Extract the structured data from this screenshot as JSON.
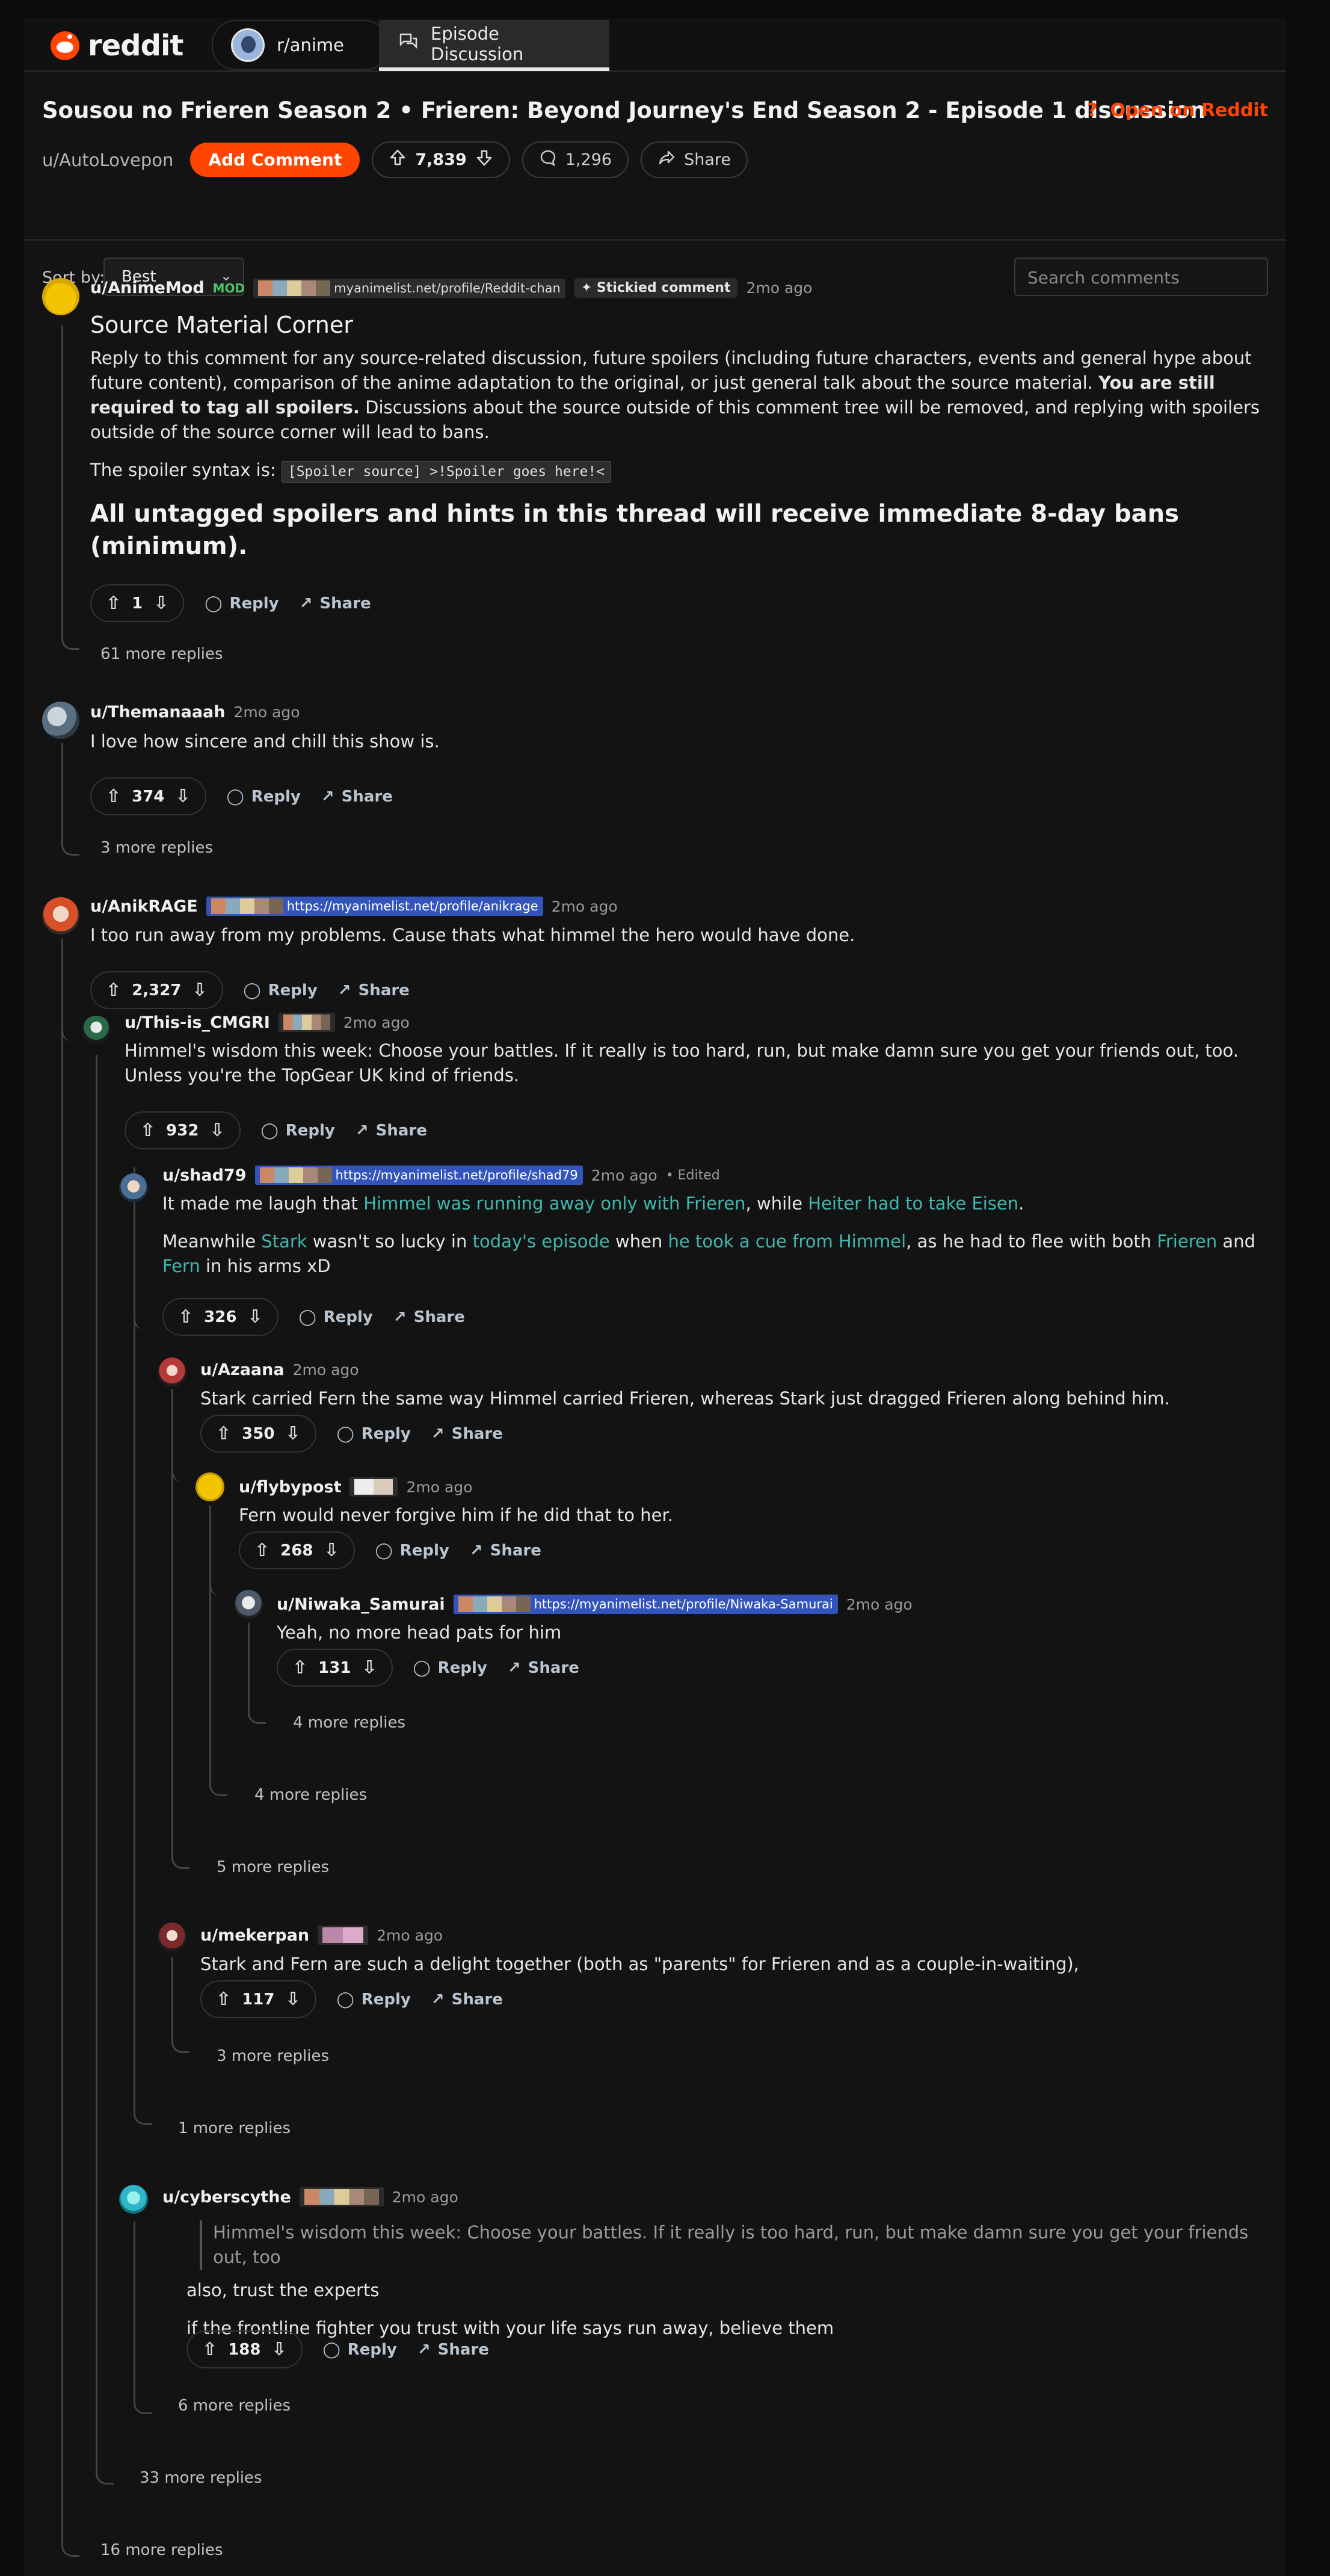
{
  "topbar": {
    "logo_text": "reddit",
    "subreddit_tab": "r/anime",
    "discussion_tab": "Episode Discussion"
  },
  "post": {
    "title": "Sousou no Frieren Season 2 • Frieren: Beyond Journey's End Season 2 - Episode 1 discussion",
    "open_on_reddit": "Open on Reddit",
    "open_icon": "?",
    "author": "u/AutoLovepon",
    "add_comment": "Add Comment",
    "score": "7,839",
    "comments": "1,296",
    "share": "Share"
  },
  "toolbar": {
    "sort_label": "Sort by:",
    "sort_value": "Best",
    "search_placeholder": "Search comments"
  },
  "comments": {
    "c1": {
      "user": "u/AnimeMod",
      "mod": "MOD",
      "flair": "myanimelist.net/profile/Reddit-chan",
      "sticky": "Stickied comment",
      "time": "2mo ago",
      "title": "Source Material Corner",
      "p1a": "Reply to this comment for any source-related discussion, future spoilers (including future characters, events and general hype about future content), comparison of the anime adaptation to the original, or just general talk about the source material. ",
      "p1b": "You are still required to tag all spoilers.",
      "p1c": " Discussions about the source outside of this comment tree will be removed, and replying with spoilers outside of the source corner will lead to bans.",
      "p2": "The spoiler syntax is: ",
      "p2code": "[Spoiler source] >!Spoiler goes here!<",
      "p3": "All untagged spoilers and hints in this thread will receive immediate 8-day bans (minimum).",
      "score": "1",
      "more": "61 more replies"
    },
    "c2": {
      "user": "u/Themanaaah",
      "time": "2mo ago",
      "text": "I love how sincere and chill this show is.",
      "score": "374",
      "more": "3 more replies"
    },
    "c3": {
      "user": "u/AnikRAGE",
      "flair": "https://myanimelist.net/profile/anikrage",
      "time": "2mo ago",
      "text": "I too run away from my problems. Cause thats what himmel the hero would have done.",
      "score": "2,327",
      "more": "16 more replies"
    },
    "c4": {
      "user": "u/This-is_CMGRI",
      "time": "2mo ago",
      "text": "Himmel's wisdom this week: Choose your battles. If it really is too hard, run, but make damn sure you get your friends out, too. Unless you're the TopGear UK kind of friends.",
      "score": "932",
      "more": "33 more replies"
    },
    "c5": {
      "user": "u/shad79",
      "flair": "https://myanimelist.net/profile/shad79",
      "time": "2mo ago",
      "edited": "• Edited",
      "l1a": "It made me laugh that ",
      "l1b": "Himmel was running away only with Frieren",
      "l1c": ", while ",
      "l1d": "Heiter had to take Eisen",
      "l1e": ".",
      "l2a": "Meanwhile ",
      "l2b": "Stark",
      "l2c": " wasn't so lucky in ",
      "l2d": "today's episode",
      "l2e": " when ",
      "l2f": "he took a cue from Himmel",
      "l2g": ", as he had to flee with both ",
      "l2h": "Frieren",
      "l2i": " and ",
      "l2j": "Fern",
      "l2k": " in his arms xD",
      "score": "326",
      "more": "1 more replies"
    },
    "c6": {
      "user": "u/Azaana",
      "time": "2mo ago",
      "text": "Stark carried Fern the same way Himmel carried Frieren, whereas Stark just dragged Frieren along behind him.",
      "score": "350",
      "more": "5 more replies"
    },
    "c7": {
      "user": "u/flybypost",
      "time": "2mo ago",
      "text": "Fern would never forgive him if he did that to her.",
      "score": "268",
      "more": "4 more replies"
    },
    "c8": {
      "user": "u/Niwaka_Samurai",
      "flair": "https://myanimelist.net/profile/Niwaka-Samurai",
      "time": "2mo ago",
      "text": "Yeah, no more head pats for him",
      "score": "131",
      "more": "4 more replies"
    },
    "c9": {
      "user": "u/mekerpan",
      "time": "2mo ago",
      "text": "Stark and Fern are such a delight together (both as \"parents\" for Frieren and as a couple-in-waiting),",
      "score": "117",
      "more": "3 more replies"
    },
    "c10": {
      "user": "u/cyberscythe",
      "time": "2mo ago",
      "quote": "Himmel's wisdom this week: Choose your battles. If it really is too hard, run, but make damn sure you get your friends out, too",
      "l1": "also, trust the experts",
      "l2": "if the frontline fighter you trust with your life says run away, believe them",
      "score": "188",
      "more": "6 more replies"
    },
    "reply": "Reply",
    "share": "Share"
  }
}
